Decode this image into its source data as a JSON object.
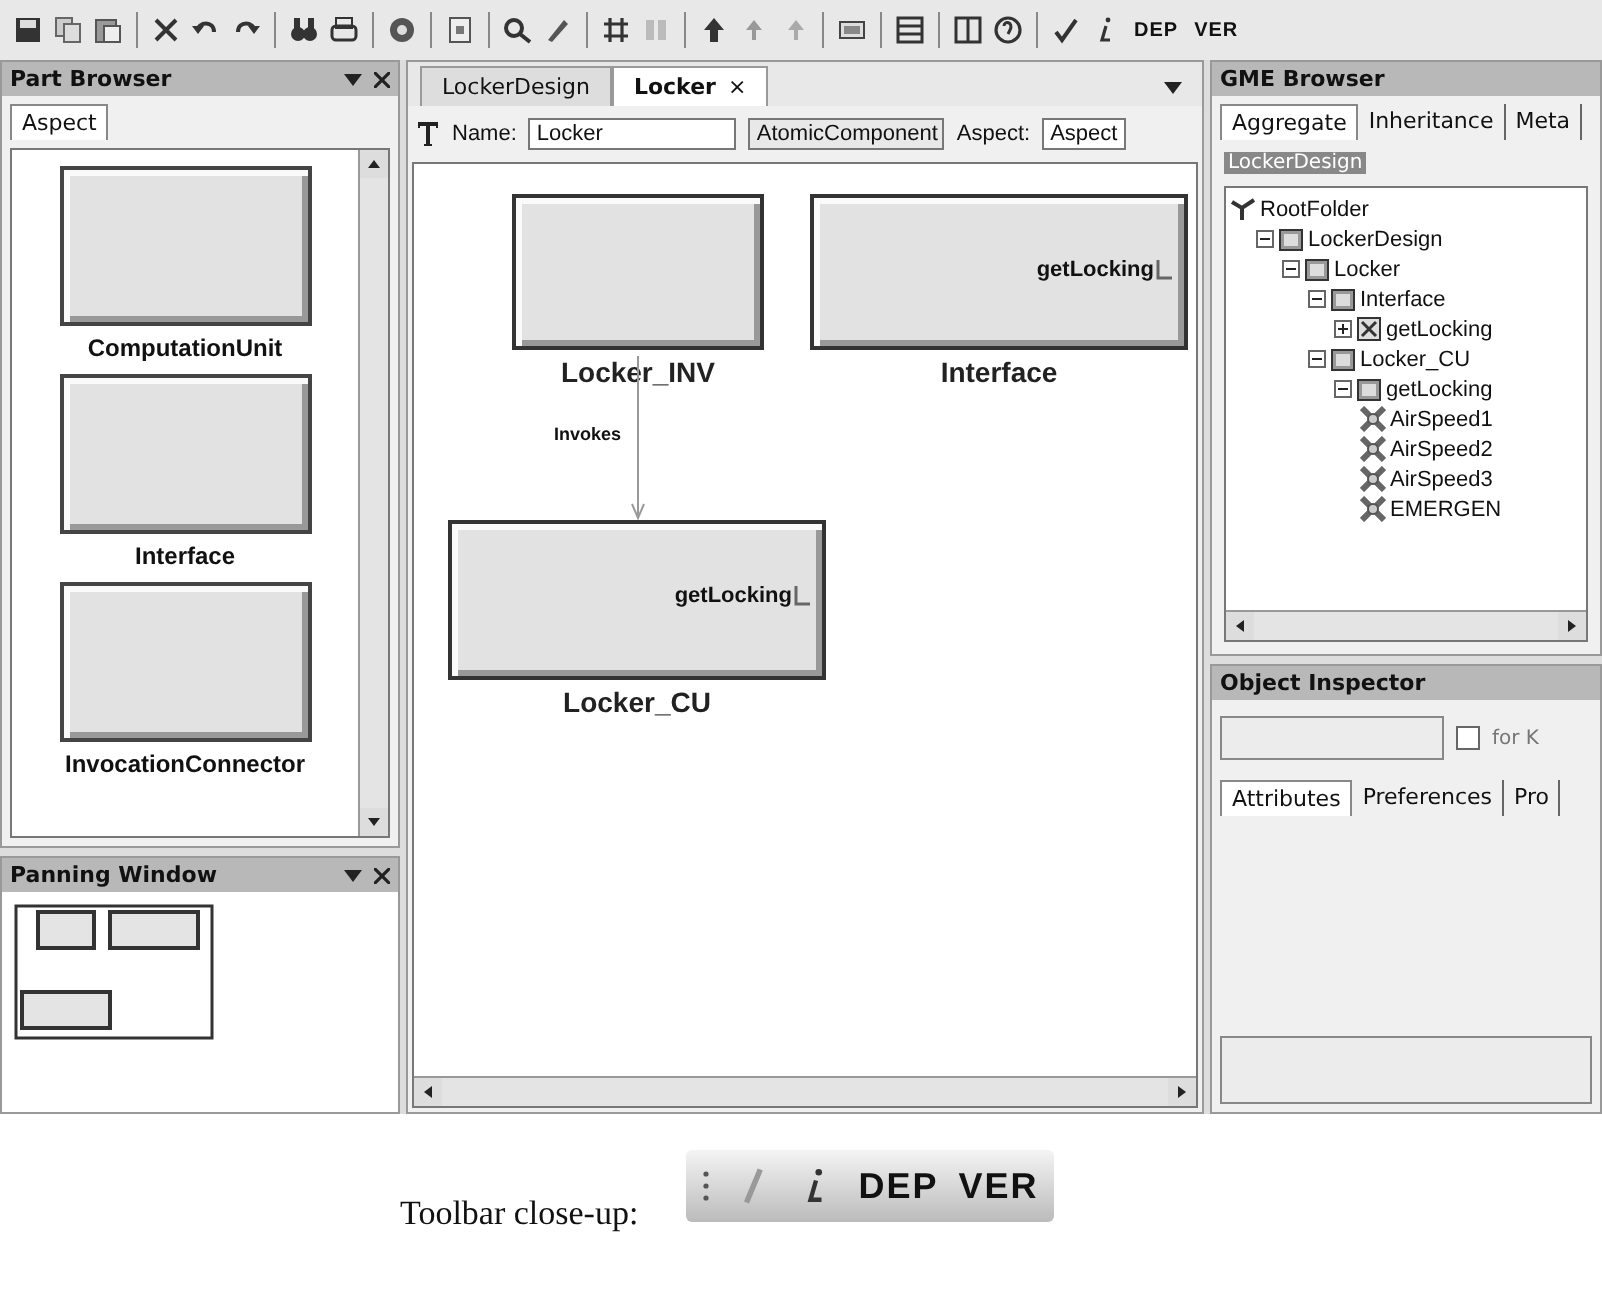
{
  "toolbar": {
    "text_buttons": [
      "DEP",
      "VER"
    ]
  },
  "part_browser": {
    "title": "Part Browser",
    "tabs": [
      {
        "label": "Aspect",
        "selected": true
      }
    ],
    "parts": [
      "ComputationUnit",
      "Interface",
      "InvocationConnector"
    ]
  },
  "panning_window": {
    "title": "Panning Window"
  },
  "editor": {
    "tabs": [
      {
        "label": "LockerDesign",
        "selected": false
      },
      {
        "label": "Locker",
        "selected": true,
        "close": "×"
      }
    ],
    "name_label": "Name:",
    "name_value": "Locker",
    "kind_value": "AtomicComponent",
    "aspect_label": "Aspect:",
    "aspect_value": "Aspect",
    "boxes": [
      {
        "label": "Locker_INV"
      },
      {
        "label": "Interface",
        "port": "getLocking"
      },
      {
        "label": "Locker_CU",
        "port": "getLocking"
      }
    ],
    "connection": {
      "label": "Invokes"
    }
  },
  "gme_browser": {
    "title": "GME Browser",
    "tabs": [
      {
        "label": "Aggregate",
        "selected": true
      },
      {
        "label": "Inheritance",
        "selected": false
      },
      {
        "label": "Meta",
        "selected": false
      }
    ],
    "filter_value": "LockerDesign",
    "tree": [
      {
        "label": "RootFolder",
        "kind": "folder",
        "children": [
          {
            "label": "LockerDesign",
            "kind": "model",
            "expanded": true,
            "children": [
              {
                "label": "Locker",
                "kind": "model",
                "expanded": true,
                "children": [
                  {
                    "label": "Interface",
                    "kind": "model",
                    "expanded": true,
                    "children": [
                      {
                        "label": "getLocking",
                        "kind": "port",
                        "expanded": false
                      }
                    ]
                  },
                  {
                    "label": "Locker_CU",
                    "kind": "model",
                    "expanded": true,
                    "children": [
                      {
                        "label": "getLocking",
                        "kind": "model",
                        "expanded": true,
                        "children": [
                          {
                            "label": "AirSpeed1",
                            "kind": "atom"
                          },
                          {
                            "label": "AirSpeed2",
                            "kind": "atom"
                          },
                          {
                            "label": "AirSpeed3",
                            "kind": "atom"
                          },
                          {
                            "label": "EMERGEN",
                            "kind": "atom"
                          }
                        ]
                      }
                    ]
                  }
                ]
              }
            ]
          }
        ]
      }
    ]
  },
  "object_inspector": {
    "title": "Object Inspector",
    "checkbox": {
      "label": "for K",
      "checked": false
    },
    "tabs": [
      {
        "label": "Attributes",
        "selected": true
      },
      {
        "label": "Preferences",
        "selected": false
      },
      {
        "label": "Pro",
        "selected": false
      }
    ]
  },
  "caption": "Toolbar close-up:",
  "closeup": {
    "text_buttons": [
      "DEP",
      "VER"
    ]
  }
}
